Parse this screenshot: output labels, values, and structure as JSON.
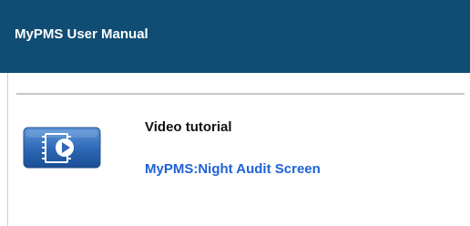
{
  "header": {
    "title": "MyPMS User Manual"
  },
  "content": {
    "video_label": "Video tutorial",
    "video_link_text": "MyPMS:Night Audit Screen"
  },
  "icons": {
    "video": "video-play-icon"
  },
  "colors": {
    "header_background": "#0f4d74",
    "header_text": "#ffffff",
    "label_text": "#111111",
    "link": "#1e62d6",
    "divider": "#c7c7c7",
    "icon_blue": "#2d67b5"
  }
}
